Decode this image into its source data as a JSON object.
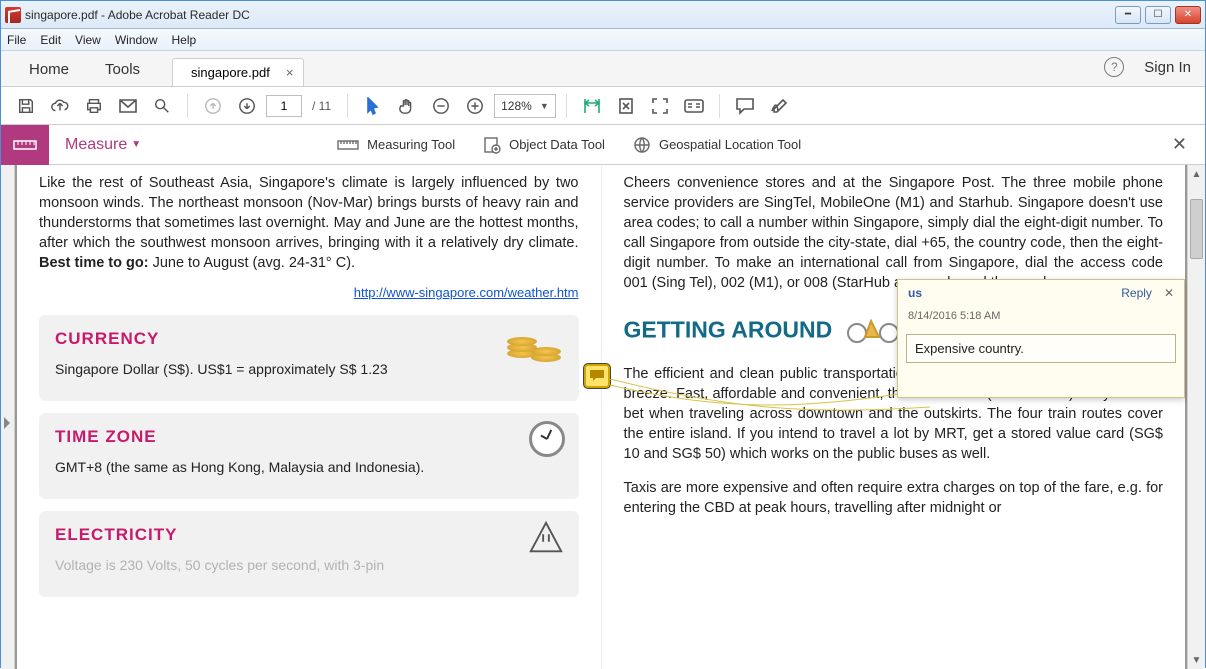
{
  "window": {
    "title": "singapore.pdf - Adobe Acrobat Reader DC"
  },
  "menu": {
    "items": [
      "File",
      "Edit",
      "View",
      "Window",
      "Help"
    ]
  },
  "tabs": {
    "home": "Home",
    "tools": "Tools",
    "doc": "singapore.pdf",
    "signin": "Sign In"
  },
  "toolbar": {
    "page_current": "1",
    "page_total": "/ 11",
    "zoom": "128%"
  },
  "measure": {
    "label": "Measure",
    "tools": {
      "measuring": "Measuring Tool",
      "objectdata": "Object Data Tool",
      "geospatial": "Geospatial Location Tool"
    }
  },
  "doc": {
    "climate_para": "Like the rest of Southeast Asia, Singapore's climate is largely influenced by two monsoon winds. The northeast monsoon (Nov-Mar) brings bursts of heavy rain and thunderstorms that sometimes last overnight. May and June are the hottest months, after which the southwest monsoon arrives, bringing with it a relatively dry climate.",
    "best_time_label": "Best time to go:",
    "best_time_value": " June to August (avg. 24-31° C).",
    "weather_link": "http://www-singapore.com/weather.htm",
    "currency_h": "CURRENCY",
    "currency_body": "Singapore Dollar (S$). US$1 = approximately S$ 1.23",
    "timezone_h": "TIME ZONE",
    "timezone_body": "GMT+8 (the same as Hong Kong, Malaysia and Indonesia).",
    "electricity_h": "ELECTRICITY",
    "electricity_body": "Voltage is 230 Volts, 50 cycles per second, with 3-pin",
    "phone_para": "Cheers convenience stores and at the Singapore Post. The three mobile phone service providers are SingTel, MobileOne (M1) and Starhub. Singapore doesn't use area codes; to call a number within Singapore, simply dial the eight-digit number. To call Singapore from outside the city-state, dial +65, the country code, then the eight-digit number. To make an international call from Singapore, dial the access code 001 (Sing Tel), 002 (M1), or 008 (StarHub                                                           area code and the number.",
    "getting_around_h": "GETTING AROUND",
    "mrt_para": "The efficient and clean public transportation in Singapore makes getting around a breeze. Fast, affordable and convenient, the MRT trains (05:30-24:00) are your best bet when traveling across downtown and the outskirts. The four train routes cover the entire island. If you intend to travel a lot by MRT, get a stored value card (SG$ 10 and SG$ 50) which works on the public buses as well.",
    "taxi_para": "Taxis are more expensive and often require extra charges on top of the fare, e.g. for entering the CBD at peak hours, travelling after midnight or"
  },
  "comment": {
    "author": "us",
    "reply": "Reply",
    "date": "8/14/2016  5:18 AM",
    "text": "Expensive country."
  }
}
